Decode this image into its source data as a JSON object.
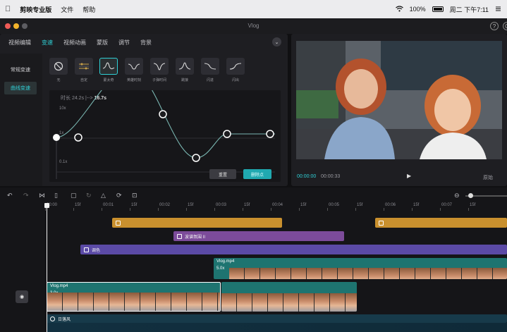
{
  "menubar": {
    "app_name": "剪映专业版",
    "file": "文件",
    "help": "帮助",
    "battery": "100%",
    "clock": "周二 下午7:11"
  },
  "window": {
    "title": "Vlog"
  },
  "tabs": [
    "视频编辑",
    "变速",
    "视频动画",
    "蒙版",
    "调节",
    "背景"
  ],
  "sidebar": {
    "items": [
      "常规变速",
      "曲线变速"
    ]
  },
  "presets": [
    {
      "label": "无",
      "icon": "none-icon"
    },
    {
      "label": "自定",
      "icon": "custom-curve-icon"
    },
    {
      "label": "蒙太奇",
      "icon": "montage-curve-icon"
    },
    {
      "label": "英雄时刻",
      "icon": "hero-moment-curve-icon"
    },
    {
      "label": "子弹时间",
      "icon": "bullet-time-curve-icon"
    },
    {
      "label": "跳接",
      "icon": "jump-cut-curve-icon"
    },
    {
      "label": "闪进",
      "icon": "flash-in-curve-icon"
    },
    {
      "label": "闪出",
      "icon": "flash-out-curve-icon"
    }
  ],
  "curve": {
    "duration_prefix": "时长 24.2s  |-->",
    "duration_value": "16.7s",
    "y_top": "10x",
    "y_mid": "1x",
    "y_bottom": "0.1x",
    "reset": "重置",
    "add_point": "删除点"
  },
  "player": {
    "current_time": "00:00:00",
    "total_time": "00:00:33",
    "options": "原始"
  },
  "timeline": {
    "ruler": [
      "00:00",
      "15f",
      "00:01",
      "15f",
      "00:02",
      "15f",
      "00:03",
      "15f",
      "00:04",
      "15f",
      "00:05",
      "15f",
      "00:06",
      "15f",
      "00:07",
      "15f"
    ],
    "clips": {
      "text_clip": "波谱氛围 II",
      "adjust_clip": "调色",
      "video_upper": "Vlog.mp4",
      "video_upper_speed": "5.0x",
      "video_main": "Vlog.mp4",
      "video_main_speed": "3.0x",
      "audio": "日落风"
    }
  },
  "colors": {
    "accent": "#2fd0d6",
    "sticker_track": "#c9902e",
    "text_track": "#7c4b9a",
    "adjust_track": "#5b4aa6",
    "video_track": "#1e7470"
  }
}
